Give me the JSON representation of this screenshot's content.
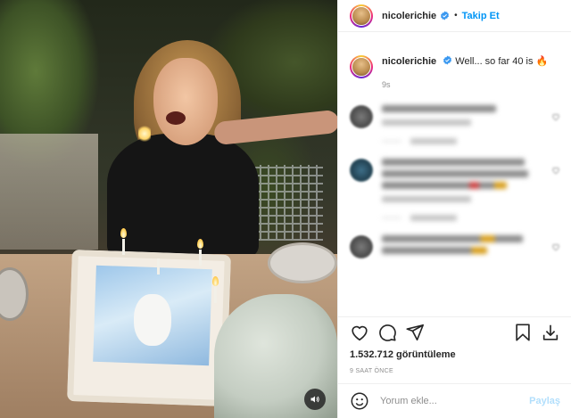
{
  "header": {
    "username": "nicolerichie",
    "separator": "•",
    "follow_label": "Takip Et"
  },
  "caption": {
    "username": "nicolerichie",
    "text": "Well... so far 40 is",
    "emoji": "🔥",
    "time": "9s"
  },
  "comments": [
    {
      "lines": [
        1
      ],
      "meta": true,
      "replies": true,
      "icon": "heart-icon"
    },
    {
      "lines": [
        1,
        1,
        0.8
      ],
      "meta": true,
      "replies": true,
      "icon": "heart-icon"
    },
    {
      "lines": [
        1,
        0.7
      ],
      "meta": false,
      "replies": false,
      "icon": "heart-icon"
    }
  ],
  "actions": {
    "views": "1.532.712 görüntüleme",
    "posted_ago": "9 SAAT ÖNCE"
  },
  "add_comment": {
    "placeholder": "Yorum ekle...",
    "post_label": "Paylaş"
  },
  "colors": {
    "accent": "#0095f6",
    "verified": "#3897f0",
    "post_disabled": "#b2dffc"
  },
  "icons": {
    "like": "heart-icon",
    "comment": "comment-icon",
    "share": "paper-plane-icon",
    "save": "bookmark-icon",
    "download": "download-icon",
    "emoji": "smiley-icon",
    "sound": "speaker-icon"
  }
}
